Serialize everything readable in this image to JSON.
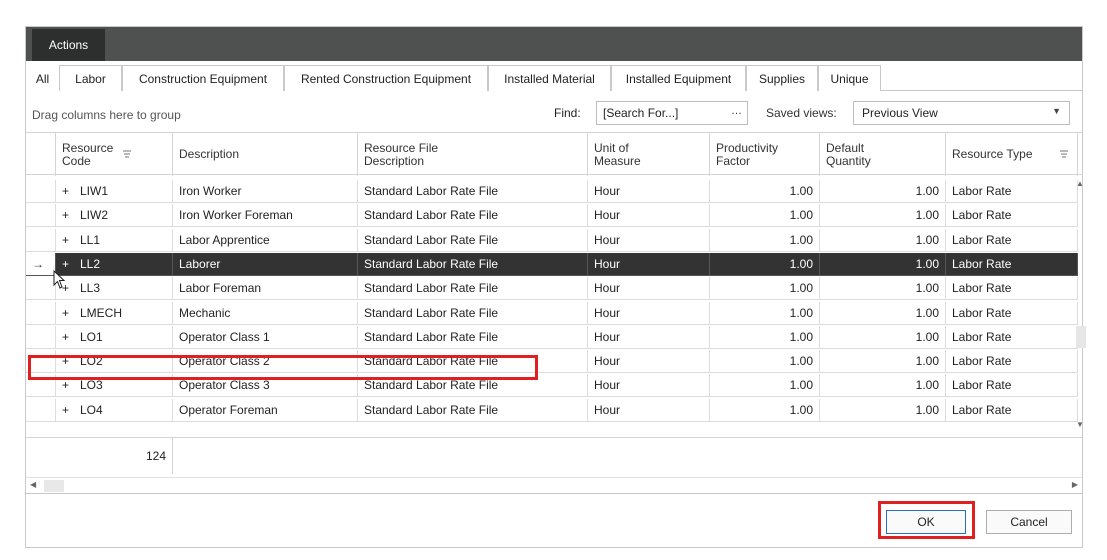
{
  "topbar": {
    "actions_label": "Actions"
  },
  "tabs": [
    {
      "label": "All"
    },
    {
      "label": "Labor"
    },
    {
      "label": "Construction Equipment"
    },
    {
      "label": "Rented Construction Equipment"
    },
    {
      "label": "Installed Material"
    },
    {
      "label": "Installed Equipment"
    },
    {
      "label": "Supplies"
    },
    {
      "label": "Unique"
    }
  ],
  "toolbar": {
    "group_hint": "Drag columns here to group",
    "find_label": "Find:",
    "find_placeholder": "[Search For...]",
    "find_button": "…",
    "saved_views_label": "Saved views:",
    "saved_views_value": "Previous View"
  },
  "columns": {
    "resource_code_1": "Resource",
    "resource_code_2": "Code",
    "description": "Description",
    "file_desc_1": "Resource File",
    "file_desc_2": "Description",
    "uom_1": "Unit of",
    "uom_2": "Measure",
    "prod_1": "Productivity",
    "prod_2": "Factor",
    "qty_1": "Default",
    "qty_2": "Quantity",
    "type": "Resource Type"
  },
  "rows": [
    {
      "code": "LIW1",
      "description": "Iron Worker",
      "file": "Standard Labor Rate File",
      "uom": "Hour",
      "prod": "1.00",
      "qty": "1.00",
      "type": "Labor Rate"
    },
    {
      "code": "LIW2",
      "description": "Iron Worker Foreman",
      "file": "Standard Labor Rate File",
      "uom": "Hour",
      "prod": "1.00",
      "qty": "1.00",
      "type": "Labor Rate"
    },
    {
      "code": "LL1",
      "description": "Labor Apprentice",
      "file": "Standard Labor Rate File",
      "uom": "Hour",
      "prod": "1.00",
      "qty": "1.00",
      "type": "Labor Rate"
    },
    {
      "code": "LL2",
      "description": "Laborer",
      "file": "Standard Labor Rate File",
      "uom": "Hour",
      "prod": "1.00",
      "qty": "1.00",
      "type": "Labor Rate"
    },
    {
      "code": "LL3",
      "description": "Labor Foreman",
      "file": "Standard Labor Rate File",
      "uom": "Hour",
      "prod": "1.00",
      "qty": "1.00",
      "type": "Labor Rate"
    },
    {
      "code": "LMECH",
      "description": "Mechanic",
      "file": "Standard Labor Rate File",
      "uom": "Hour",
      "prod": "1.00",
      "qty": "1.00",
      "type": "Labor Rate"
    },
    {
      "code": "LO1",
      "description": "Operator Class 1",
      "file": "Standard Labor Rate File",
      "uom": "Hour",
      "prod": "1.00",
      "qty": "1.00",
      "type": "Labor Rate"
    },
    {
      "code": "LO2",
      "description": "Operator Class 2",
      "file": "Standard Labor Rate File",
      "uom": "Hour",
      "prod": "1.00",
      "qty": "1.00",
      "type": "Labor Rate"
    },
    {
      "code": "LO3",
      "description": "Operator Class 3",
      "file": "Standard Labor Rate File",
      "uom": "Hour",
      "prod": "1.00",
      "qty": "1.00",
      "type": "Labor Rate"
    },
    {
      "code": "LO4",
      "description": "Operator Foreman",
      "file": "Standard Labor Rate File",
      "uom": "Hour",
      "prod": "1.00",
      "qty": "1.00",
      "type": "Labor Rate"
    }
  ],
  "selected_row_marker": "→",
  "expand_glyph": "+",
  "footer": {
    "count": "124"
  },
  "buttons": {
    "ok": "OK",
    "cancel": "Cancel"
  },
  "colors": {
    "topbar": "#4e5150",
    "actions_tab": "#2d2f2e",
    "selected_row": "#333333",
    "highlight": "#e02020"
  }
}
